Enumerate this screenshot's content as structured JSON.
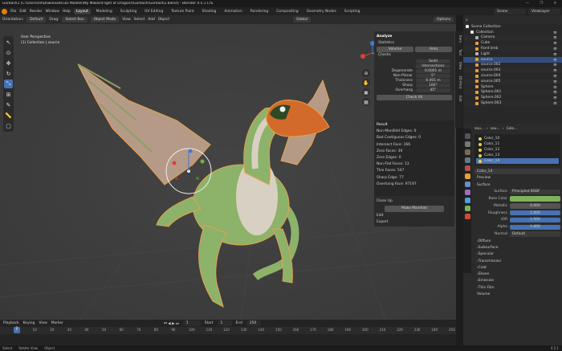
{
  "window": {
    "title": "Gorbash2 [C:\\Users\\s9\\Downloads\\3D Models\\My Makes\\Flight of Dragons\\Gorbash\\Gorbash2.blend] - Blender 4.5.1 LTS",
    "controls": [
      "—",
      "❐",
      "✕"
    ]
  },
  "menu": [
    "File",
    "Edit",
    "Render",
    "Window",
    "Help"
  ],
  "workspaces": [
    "Layout",
    "Modeling",
    "Sculpting",
    "UV Editing",
    "Texture Paint",
    "Shading",
    "Animation",
    "Rendering",
    "Compositing",
    "Geometry Nodes",
    "Scripting"
  ],
  "active_workspace": "Layout",
  "scene": "Scene",
  "view_layer": "ViewLayer",
  "viewport_header": {
    "orientation_label": "Orientation:",
    "orientation": "Default",
    "drag_label": "Drag:",
    "drag": "Select Box",
    "mode": "Object Mode",
    "menus": [
      "View",
      "Select",
      "Add",
      "Object"
    ],
    "transform": "Global",
    "options": "Options"
  },
  "viewport": {
    "perspective": "User Perspective",
    "collection_info": "(1) Collection | source"
  },
  "npanel": {
    "title": "Analyze",
    "statistics": "Statistics",
    "volume_btn": "Volume",
    "area_btn": "Area",
    "checks": "Checks",
    "solid": "Solid",
    "intersections": "Intersections",
    "checks_rows": [
      {
        "l": "Degenerate",
        "v": "0.0001 m"
      },
      {
        "l": "Non-Planar",
        "v": "5°"
      },
      {
        "l": "Thickness",
        "v": "0.001 m"
      },
      {
        "l": "Sharp",
        "v": "160°"
      },
      {
        "l": "Overhang",
        "v": "45°"
      }
    ],
    "check_all": "Check All",
    "result": "Result",
    "results": [
      "Non-Manifold Edges: 0",
      "Bad Contiguous Edges: 0",
      "Intersect Face: 166",
      "Zero Faces: 39",
      "Zero Edges: 0",
      "Non-Flat Faces: 13",
      "Thin Faces: 547",
      "Sharp Edge: 77",
      "Overhang Face: 97197"
    ],
    "cleanup": "Clean Up",
    "make_manifold": "Make Manifold",
    "edit": "Edit",
    "export": "Export"
  },
  "sidetabs": [
    "Item",
    "Tool",
    "View",
    "3D-Print",
    "Edit"
  ],
  "outliner": {
    "root": "Scene Collection",
    "items": [
      {
        "name": "Collection",
        "indent": 1,
        "color": "#e8e8e8"
      },
      {
        "name": "Camera",
        "indent": 2,
        "color": "#b0b0b0"
      },
      {
        "name": "Cube",
        "indent": 2,
        "color": "#e69f3a"
      },
      {
        "name": "front limb",
        "indent": 2,
        "color": "#e69f3a"
      },
      {
        "name": "Light",
        "indent": 2,
        "color": "#b0b0b0"
      },
      {
        "name": "source",
        "indent": 2,
        "color": "#e69f3a",
        "sel": true
      },
      {
        "name": "source.002",
        "indent": 2,
        "color": "#e69f3a"
      },
      {
        "name": "source.003",
        "indent": 2,
        "color": "#e69f3a"
      },
      {
        "name": "source.004",
        "indent": 2,
        "color": "#e69f3a"
      },
      {
        "name": "source.005",
        "indent": 2,
        "color": "#e69f3a"
      },
      {
        "name": "Sphere",
        "indent": 2,
        "color": "#e69f3a"
      },
      {
        "name": "Sphere.001",
        "indent": 2,
        "color": "#e69f3a"
      },
      {
        "name": "Sphere.002",
        "indent": 2,
        "color": "#e69f3a"
      },
      {
        "name": "Sphere.003",
        "indent": 2,
        "color": "#e69f3a"
      }
    ]
  },
  "props": {
    "breadcrumb": [
      "sou...",
      "sou...",
      "Colo..."
    ],
    "materials": [
      "Color_10",
      "Color_11",
      "Color_12",
      "Color_13",
      "Color_14"
    ],
    "active_material": "Color_14",
    "mat_field": "Color_14",
    "preview": "Preview",
    "surface": "Surface",
    "rows": [
      {
        "l": "Surface",
        "v": "Principled BSDF"
      },
      {
        "l": "Base Color",
        "v": ""
      },
      {
        "l": "Metallic",
        "v": "0.000"
      },
      {
        "l": "Roughness",
        "v": "1.000"
      },
      {
        "l": "IOR",
        "v": "1.500"
      },
      {
        "l": "Alpha",
        "v": "1.000"
      },
      {
        "l": "Normal",
        "v": "Default"
      }
    ],
    "subs": [
      "Diffuse",
      "Subsurface",
      "Specular",
      "Transmission",
      "Coat",
      "Sheen",
      "Emission",
      "Thin Film"
    ],
    "volume": "Volume",
    "base_color": "#7fb25a"
  },
  "timeline": {
    "menus": [
      "Playback",
      "Keying",
      "View",
      "Marker"
    ],
    "current": "1",
    "start_label": "Start",
    "start": "1",
    "end_label": "End",
    "end": "250",
    "ticks": [
      "1",
      "10",
      "20",
      "30",
      "40",
      "50",
      "60",
      "70",
      "80",
      "90",
      "100",
      "110",
      "120",
      "130",
      "140",
      "150",
      "160",
      "170",
      "180",
      "190",
      "200",
      "210",
      "220",
      "230",
      "240",
      "250"
    ]
  },
  "status": {
    "select": "Select",
    "rotate": "Rotate View",
    "object": "Object",
    "version": "4.5.1"
  }
}
